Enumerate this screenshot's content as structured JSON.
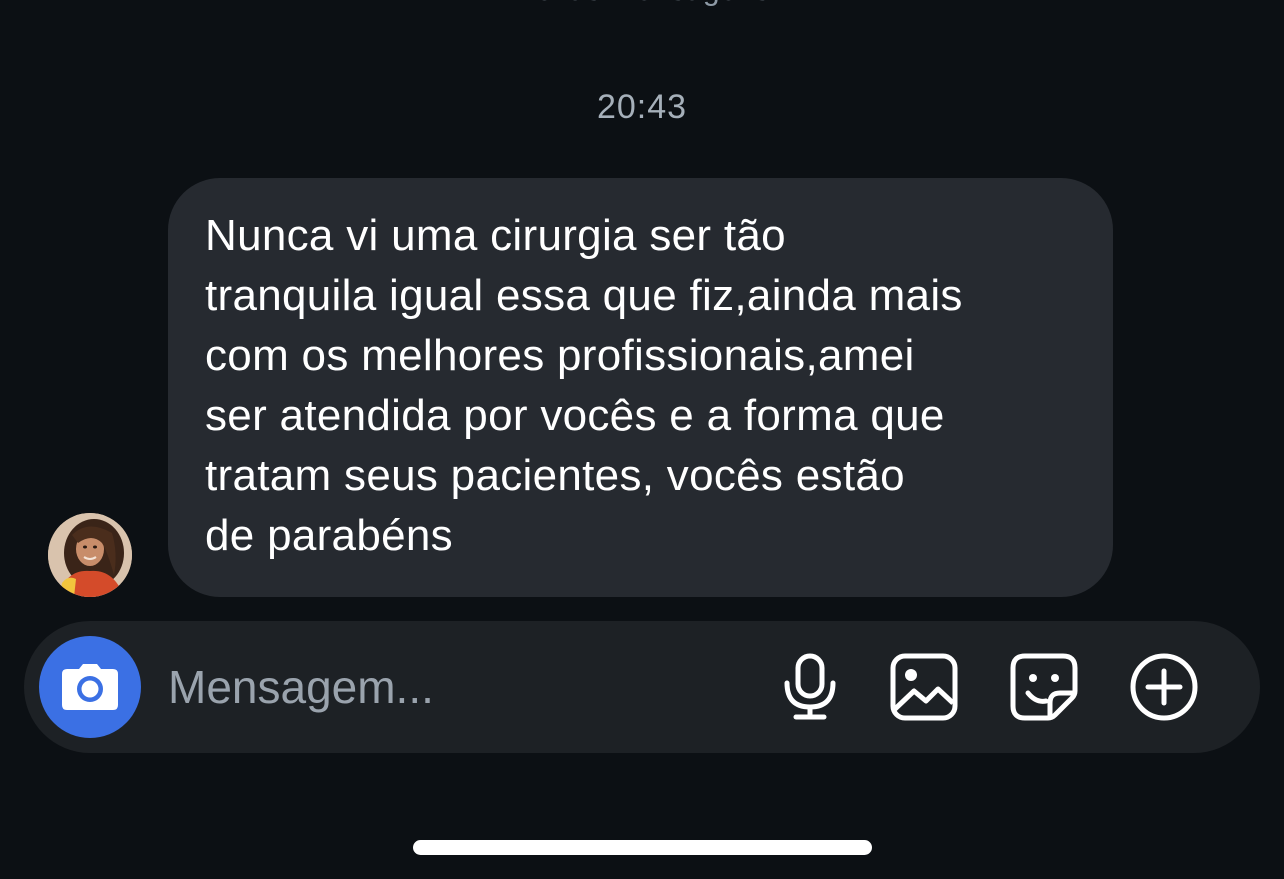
{
  "chat": {
    "new_messages_label": "Novas mensagens",
    "timestamp": "20:43",
    "message": {
      "text": "Nunca vi uma cirurgia ser tão\ntranquila igual essa que fiz,ainda mais\ncom os melhores profissionais,amei\nser atendida por vocês e a forma que\ntratam seus pacientes, vocês estão\nde parabéns"
    },
    "avatar_icon": "profile-photo"
  },
  "composer": {
    "placeholder": "Mensagem...",
    "value": "",
    "icons": [
      "camera-icon",
      "microphone-icon",
      "image-icon",
      "sticker-icon",
      "plus-circle-icon"
    ]
  },
  "colors": {
    "background": "#0c1014",
    "bubble": "#262a30",
    "composer": "#1d2125",
    "camera_button": "#3b70e4",
    "text": "#ffffff",
    "muted_text": "#a6b0ba"
  }
}
